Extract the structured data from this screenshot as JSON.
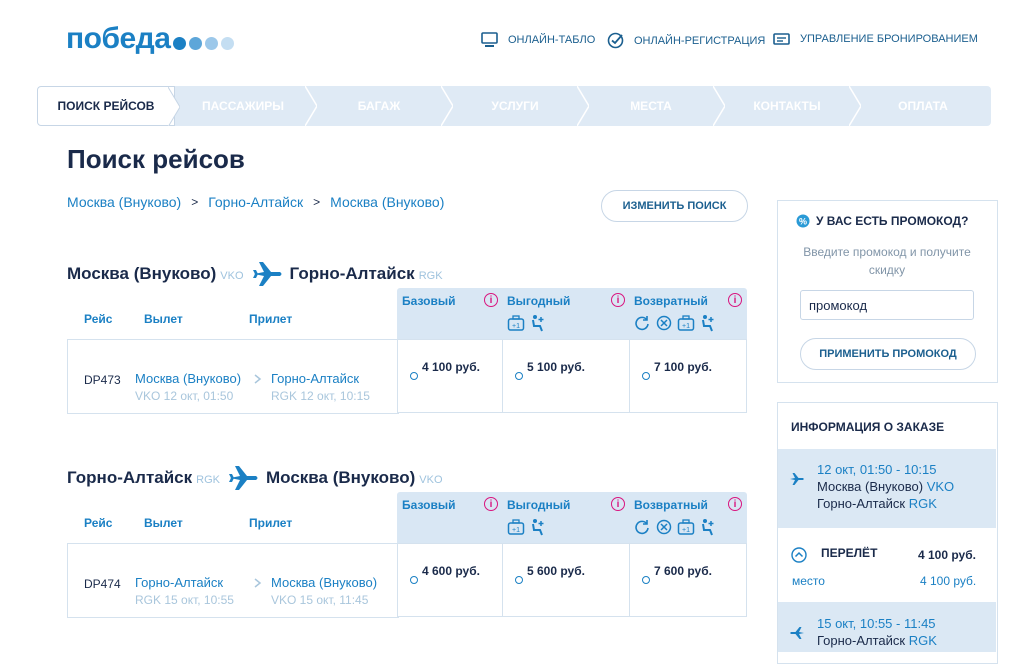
{
  "brand": {
    "logo_text": "победа",
    "dot_colors": [
      "#1b80c4",
      "#5da6d9",
      "#9cc8ea",
      "#c4def2"
    ]
  },
  "topnav": [
    {
      "label": "Онлайн-табло",
      "icon": "monitor-icon"
    },
    {
      "label": "Онлайн-регистрация",
      "icon": "check-circle-icon"
    },
    {
      "label": "Управление бронированием",
      "icon": "card-icon"
    }
  ],
  "steps": [
    "Поиск рейсов",
    "Пассажиры",
    "Багаж",
    "Услуги",
    "Места",
    "Контакты",
    "Оплата"
  ],
  "page_title": "Поиск рейсов",
  "route": [
    "Москва (Внуково)",
    "Горно-Алтайск",
    "Москва (Внуково)"
  ],
  "route_sep": ">",
  "change_search_label": "Изменить поиск",
  "columns": {
    "flight": "Рейс",
    "departure": "Вылет",
    "arrival": "Прилет"
  },
  "fares": [
    "Базовый",
    "Выгодный",
    "Возвратный"
  ],
  "info_glyph": "i",
  "legs": [
    {
      "from": "Москва (Внуково)",
      "from_code": "VKO",
      "to": "Горно-Алтайск",
      "to_code": "RGK",
      "flight_no": "DP473",
      "dep_city": "Москва (Внуково)",
      "dep_info": "VKO 12 окт, 01:50",
      "arr_city": "Горно-Алтайск",
      "arr_info": "RGK 12 окт, 10:15",
      "prices": [
        "4 100 руб.",
        "5 100 руб.",
        "7 100 руб."
      ]
    },
    {
      "from": "Горно-Алтайск",
      "from_code": "RGK",
      "to": "Москва (Внуково)",
      "to_code": "VKO",
      "flight_no": "DP474",
      "dep_city": "Горно-Алтайск",
      "dep_info": "RGK 15 окт, 10:55",
      "arr_city": "Москва (Внуково)",
      "arr_info": "VKO 15 окт, 11:45",
      "prices": [
        "4 600 руб.",
        "5 600 руб.",
        "7 600 руб."
      ]
    }
  ],
  "promo": {
    "title": "У вас есть промокод?",
    "text": "Введите промокод и получите скидку",
    "input_value": "промокод",
    "apply_label": "Применить промокод"
  },
  "order": {
    "title": "Информация о заказе",
    "seg1": {
      "time": "12 окт, 01:50 - 10:15",
      "city": "Москва (Внуково)",
      "code": "VKO",
      "dest": "Горно-Алтайск",
      "dest_code": "RGK"
    },
    "flight_label": "Перелёт",
    "flight_price": "4 100 руб.",
    "seat_label": "место",
    "seat_price": "4 100 руб.",
    "seg2": {
      "time": "15 окт, 10:55 - 11:45",
      "city": "Горно-Алтайск",
      "code": "RGK"
    }
  },
  "colors": {
    "brand_blue": "#1b80c4",
    "dark": "#1a2a4a",
    "accent_pink": "#d9157f",
    "light_bg": "#d9e7f4"
  }
}
